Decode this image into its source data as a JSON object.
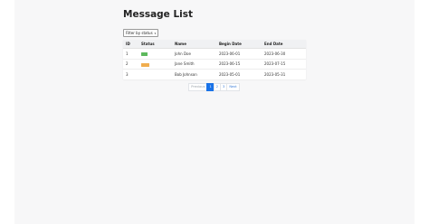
{
  "page": {
    "title": "Message List"
  },
  "filter": {
    "label": "Filter by status",
    "caret": "▾"
  },
  "table": {
    "headers": [
      "ID",
      "Status",
      "Name",
      "Begin Date",
      "End Date"
    ],
    "rows": [
      {
        "id": "1",
        "status": {
          "color": "#5cb85c"
        },
        "name": "John Doe",
        "begin": "2023-06-01",
        "end": "2023-06-30"
      },
      {
        "id": "2",
        "status": {
          "color": "#f0ad4e"
        },
        "name": "Jane Smith",
        "begin": "2023-06-15",
        "end": "2023-07-15"
      },
      {
        "id": "3",
        "status": null,
        "name": "Bob Johnson",
        "begin": "2023-05-01",
        "end": "2023-05-31"
      }
    ]
  },
  "pagination": {
    "previous": "Previous",
    "pages": [
      "1",
      "2",
      "3"
    ],
    "active_page": "1",
    "next": "Next"
  }
}
